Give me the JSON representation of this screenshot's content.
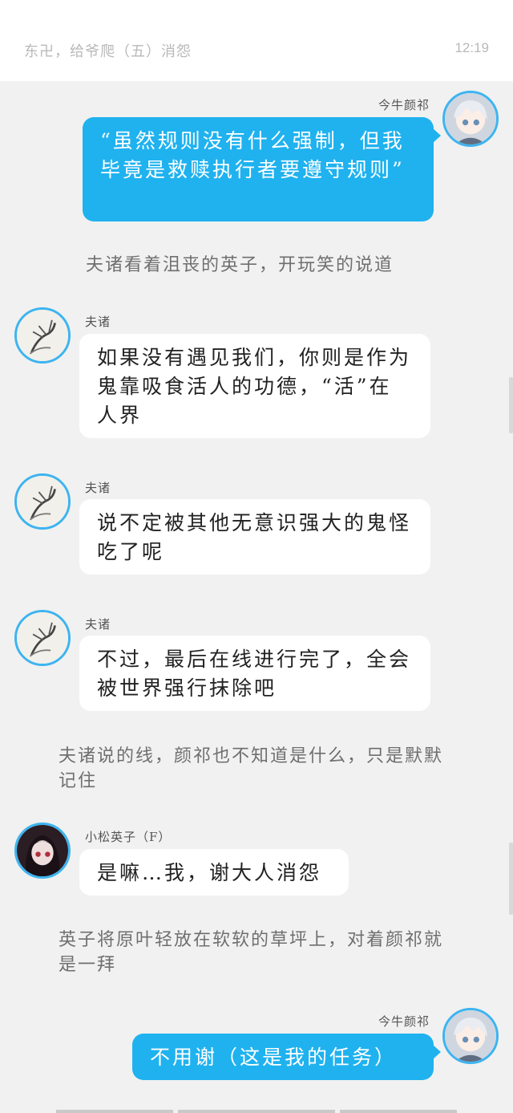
{
  "header": {
    "title": "东卍，给爷爬（五）消怨",
    "time": "12:19"
  },
  "characters": {
    "protagonist": {
      "name": "今牛颜祁",
      "avatar_icon": "anime-boy-avatar-icon"
    },
    "fuzhu": {
      "name": "夫诸",
      "avatar_icon": "ink-deer-avatar-icon"
    },
    "yingzi": {
      "name": "小松英子（F）",
      "avatar_icon": "dark-hair-girl-avatar-icon"
    }
  },
  "messages": [
    {
      "kind": "right",
      "speaker": "今牛颜祁",
      "text": "“虽然规则没有什么强制，但我毕竟是救赎执行者要遵守规则”"
    },
    {
      "kind": "narration",
      "text": "夫诸看着沮丧的英子，开玩笑的说道"
    },
    {
      "kind": "left",
      "speaker": "夫诸",
      "text": "如果没有遇见我们，你则是作为鬼靠吸食活人的功德，“活”在人界"
    },
    {
      "kind": "left",
      "speaker": "夫诸",
      "text": "说不定被其他无意识强大的鬼怪吃了呢"
    },
    {
      "kind": "left",
      "speaker": "夫诸",
      "text": "不过，最后在线进行完了，全会被世界强行抹除吧"
    },
    {
      "kind": "narration",
      "text": "夫诸说的线，颜祁也不知道是什么，只是默默记住"
    },
    {
      "kind": "left",
      "speaker": "小松英子（F）",
      "text": "是嘛…我，谢大人消怨"
    },
    {
      "kind": "narration",
      "text": "英子将原叶轻放在软软的草坪上，对着颜祁就是一拜"
    },
    {
      "kind": "right",
      "speaker": "今牛颜祁",
      "text": "不用谢（这是我的任务）"
    }
  ],
  "colors": {
    "background": "#f1f1f1",
    "accent_blue": "#1fb2ef",
    "avatar_ring": "#3db4f0"
  }
}
